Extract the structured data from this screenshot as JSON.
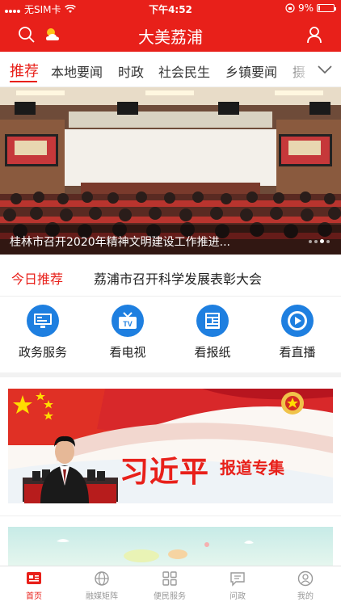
{
  "status_bar": {
    "carrier": "无SIM卡",
    "time": "下午4:52",
    "battery": "9%"
  },
  "header": {
    "title": "大美荔浦"
  },
  "tabs": [
    {
      "label": "推荐",
      "active": true
    },
    {
      "label": "本地要闻"
    },
    {
      "label": "时政"
    },
    {
      "label": "社会民生"
    },
    {
      "label": "乡镇要闻"
    },
    {
      "label": "摄"
    }
  ],
  "banner": {
    "caption": "桂林市召开2020年精神文明建设工作推进..."
  },
  "today": {
    "label": "今日推荐",
    "headline": "荔浦市召开科学发展表彰大会"
  },
  "services": [
    {
      "label": "政务服务",
      "icon": "monitor-icon"
    },
    {
      "label": "看电视",
      "icon": "tv-icon"
    },
    {
      "label": "看报纸",
      "icon": "newspaper-icon"
    },
    {
      "label": "看直播",
      "icon": "play-icon"
    }
  ],
  "promo": {
    "title": "习近平",
    "subtitle": "报道专集"
  },
  "bottom_nav": [
    {
      "label": "首页",
      "icon": "home-icon",
      "active": true
    },
    {
      "label": "融媒矩阵",
      "icon": "globe-icon"
    },
    {
      "label": "便民服务",
      "icon": "grid-icon"
    },
    {
      "label": "问政",
      "icon": "chat-icon"
    },
    {
      "label": "我的",
      "icon": "profile-icon"
    }
  ],
  "colors": {
    "brand_red": "#e8201a",
    "service_blue": "#1e7fe0"
  }
}
